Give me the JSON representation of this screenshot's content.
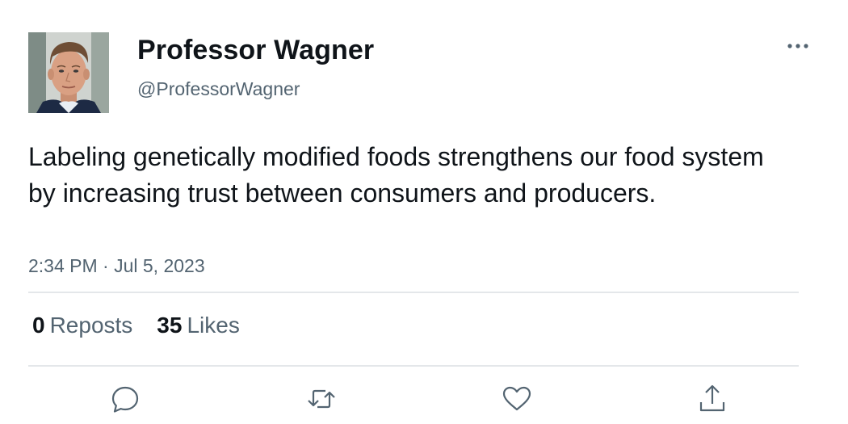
{
  "author": {
    "name": "Professor Wagner",
    "handle": "@ProfessorWagner"
  },
  "tweet": {
    "text": "Labeling genetically modified foods strengthens our food system by increasing trust between consumers and producers.",
    "timestamp": "2:34 PM · Jul 5, 2023"
  },
  "stats": {
    "reposts_count": "0",
    "reposts_label": "Reposts",
    "likes_count": "35",
    "likes_label": "Likes"
  },
  "icons": {
    "more": "more-horizontal-icon",
    "reply": "reply-icon",
    "repost": "repost-icon",
    "like": "heart-icon",
    "share": "share-icon"
  },
  "colors": {
    "text_primary": "#0f1419",
    "text_secondary": "#536471",
    "divider": "#e4e7ea"
  }
}
